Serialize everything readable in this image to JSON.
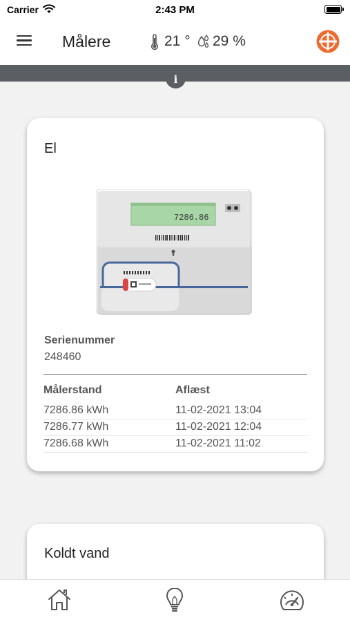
{
  "status_bar": {
    "carrier": "Carrier",
    "time": "2:43 PM",
    "icons": [
      "wifi-icon",
      "battery-icon"
    ]
  },
  "header": {
    "menu_icon": "hamburger-menu-icon",
    "title": "Målere",
    "temperature": "21 °",
    "humidity": "29 %",
    "logo_color": "#ee6a2f"
  },
  "info_tab": {
    "label": "i"
  },
  "cards": [
    {
      "title": "El",
      "meter_display": "7286.86",
      "serial_label": "Serienummer",
      "serial_value": "248460",
      "table": {
        "headers": [
          "Målerstand",
          "Aflæst"
        ],
        "rows": [
          [
            "7286.86 kWh",
            "11-02-2021 13:04"
          ],
          [
            "7286.77 kWh",
            "11-02-2021 12:04"
          ],
          [
            "7286.68 kWh",
            "11-02-2021 11:02"
          ]
        ]
      }
    },
    {
      "title": "Koldt vand"
    }
  ],
  "tab_bar": {
    "tabs": [
      "home-icon",
      "lightbulb-icon",
      "gauge-icon"
    ]
  },
  "colors": {
    "accent": "#ee6a2f",
    "strip": "#5b5e63",
    "background": "#f2f2f2"
  }
}
